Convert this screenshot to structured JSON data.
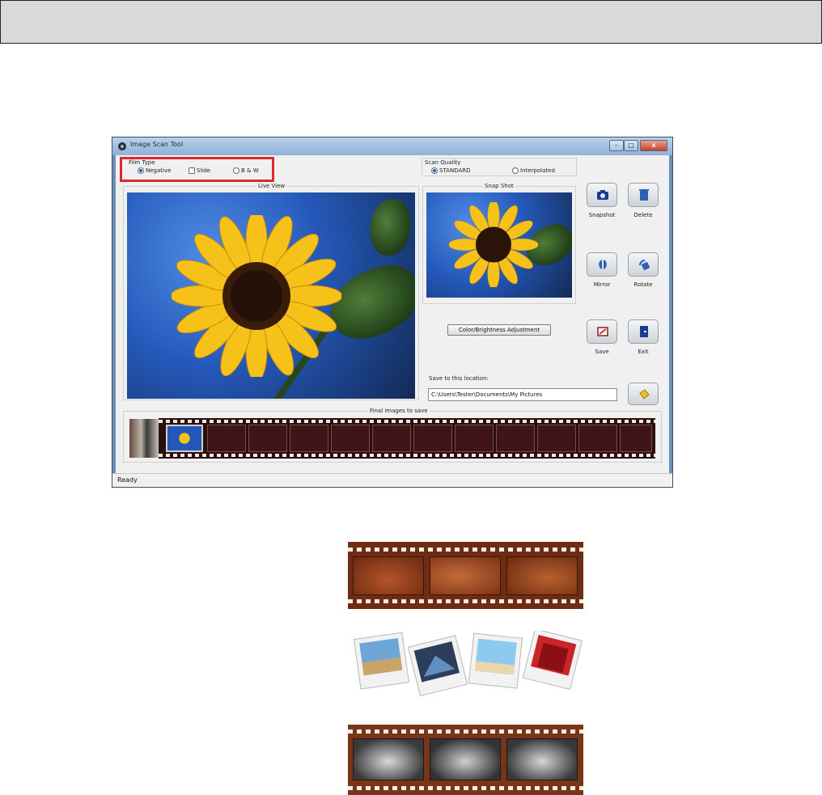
{
  "window": {
    "title": "Image Scan Tool",
    "status": "Ready",
    "controls": {
      "minimize": "–",
      "maximize": "□",
      "close": "x"
    }
  },
  "film_type": {
    "label": "Film Type",
    "options": [
      "Negative",
      "Slide",
      "B & W"
    ],
    "selected": "Negative"
  },
  "scan_quality": {
    "label": "Scan Quality",
    "options": [
      "STANDARD",
      "Interpolated"
    ],
    "selected": "STANDARD"
  },
  "panels": {
    "live_view": "Live View",
    "snap_shot": "Snap Shot",
    "final_images": "Final images to save"
  },
  "buttons": {
    "snapshot": "Snapshot",
    "delete": "Delete",
    "mirror": "Mirror",
    "rotate": "Rotate",
    "save": "Save",
    "exit": "Exit",
    "color_brightness": "Color/Brightness Adjustment"
  },
  "save_location": {
    "label": "Save to this location:",
    "path": "C:\\Users\\Tester\\Documents\\My Pictures"
  },
  "icons": [
    "camera-icon",
    "trash-icon",
    "mirror-icon",
    "rotate-icon",
    "save-icon",
    "exit-icon",
    "folder-icon"
  ],
  "colors": {
    "highlight_box": "#e0262f",
    "film": "#2a0f0f",
    "title_bar": "#8fb2d6"
  }
}
